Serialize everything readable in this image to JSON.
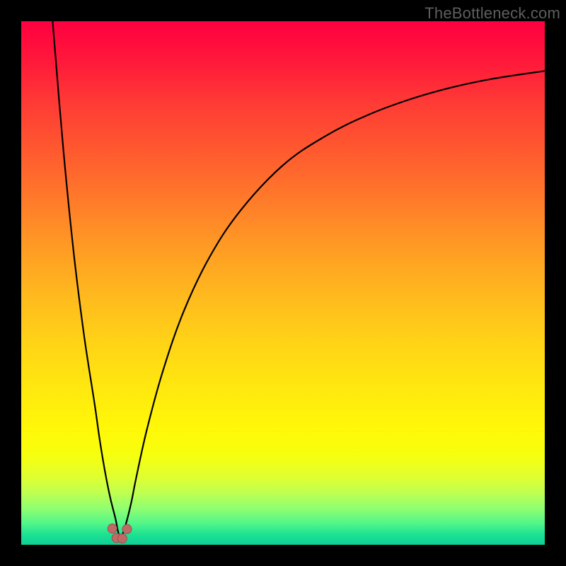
{
  "watermark": {
    "text": "TheBottleneck.com"
  },
  "colors": {
    "frame": "#000000",
    "curve": "#000000",
    "marker_fill": "#c06a66",
    "marker_stroke": "#9a4f4c",
    "gradient_top": "#ff0040",
    "gradient_bottom": "#0fcf96"
  },
  "chart_data": {
    "type": "line",
    "title": "",
    "xlabel": "",
    "ylabel": "",
    "xlim": [
      0,
      100
    ],
    "ylim": [
      0,
      100
    ],
    "grid": false,
    "legend": false,
    "notch_x": 19,
    "series": [
      {
        "name": "left-branch",
        "x": [
          6,
          8,
          10,
          12,
          14,
          15,
          16,
          17,
          18,
          18.5,
          19
        ],
        "y": [
          100,
          76,
          56,
          40,
          27,
          20,
          14,
          9,
          5,
          2.5,
          1
        ]
      },
      {
        "name": "right-branch",
        "x": [
          19,
          20,
          21,
          22,
          24,
          27,
          31,
          36,
          42,
          50,
          58,
          66,
          74,
          82,
          90,
          100
        ],
        "y": [
          1,
          4,
          8,
          13,
          22,
          33,
          44.5,
          55,
          64,
          72.5,
          78,
          82,
          85,
          87.3,
          89,
          90.5
        ]
      }
    ],
    "markers": [
      {
        "x": 17.4,
        "y": 3.1
      },
      {
        "x": 18.2,
        "y": 1.3
      },
      {
        "x": 19.3,
        "y": 1.2
      },
      {
        "x": 20.2,
        "y": 3.0
      }
    ]
  }
}
